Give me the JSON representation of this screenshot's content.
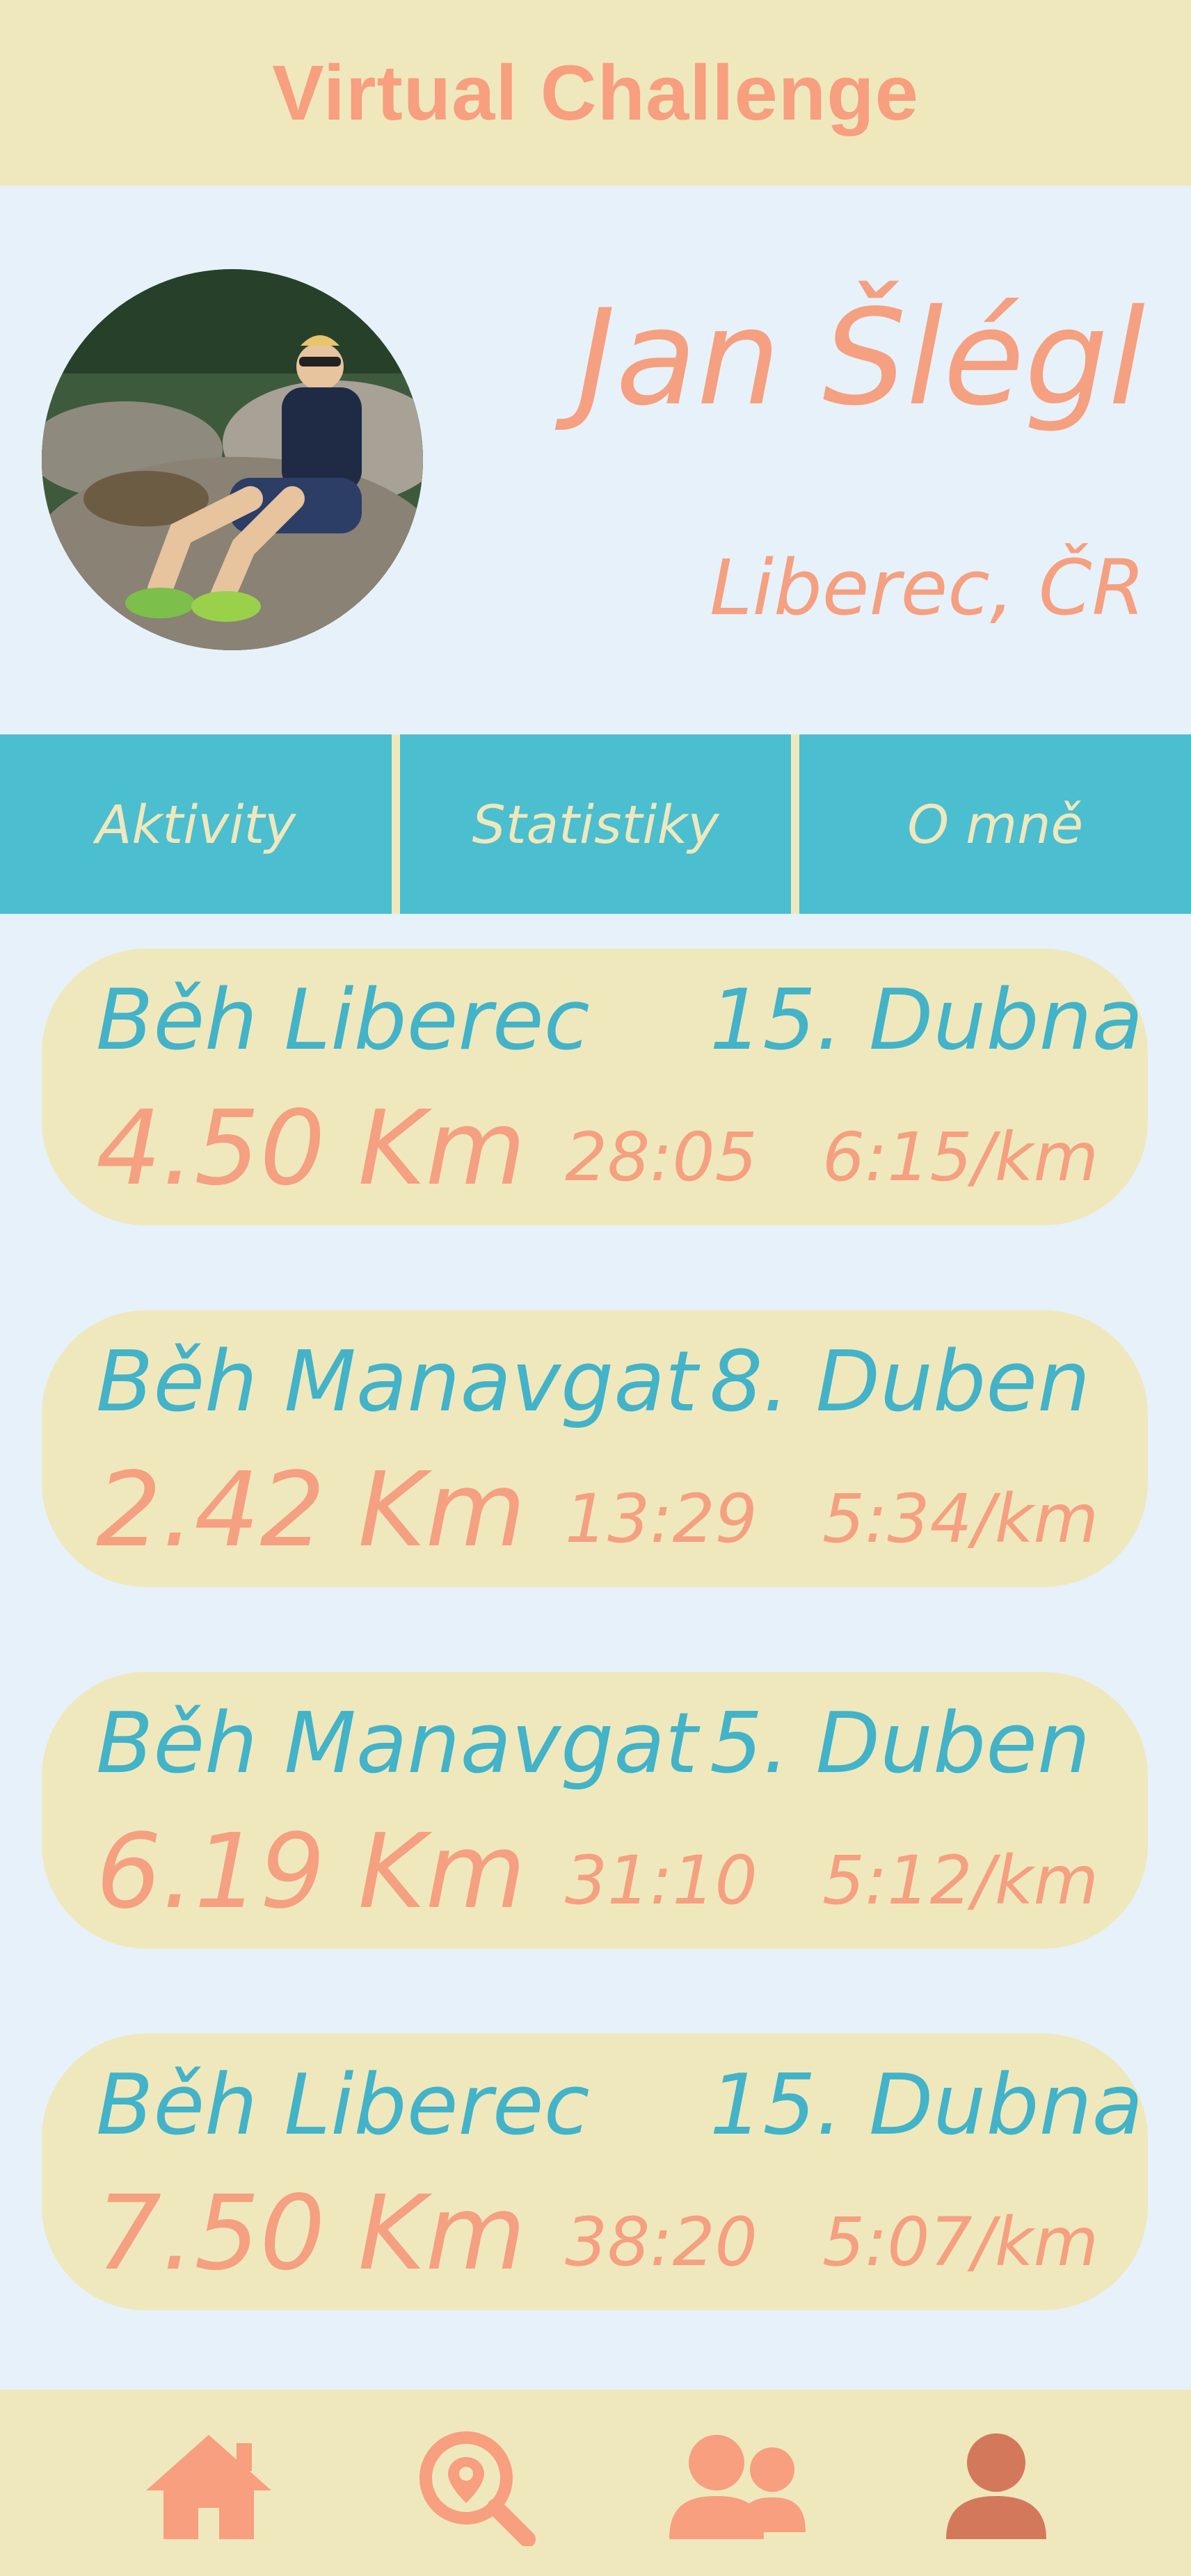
{
  "header": {
    "title": "Virtual Challenge"
  },
  "profile": {
    "name": "Jan Šlégl",
    "location": "Liberec, ČR"
  },
  "tabs": [
    {
      "label": "Aktivity"
    },
    {
      "label": "Statistiky"
    },
    {
      "label": "O mně"
    }
  ],
  "activities": [
    {
      "name": "Běh Liberec",
      "date": "15. Dubna",
      "distance": "4.50 Km",
      "time": "28:05",
      "pace": "6:15/km"
    },
    {
      "name": "Běh Manavgat",
      "date": "8. Duben",
      "distance": "2.42 Km",
      "time": "13:29",
      "pace": "5:34/km"
    },
    {
      "name": "Běh Manavgat",
      "date": "5. Duben",
      "distance": "6.19 Km",
      "time": "31:10",
      "pace": "5:12/km"
    },
    {
      "name": "Běh Liberec",
      "date": "15. Dubna",
      "distance": "7.50 Km",
      "time": "38:20",
      "pace": "5:07/km"
    }
  ],
  "nav": {
    "items": [
      {
        "icon": "home-icon"
      },
      {
        "icon": "location-search-icon"
      },
      {
        "icon": "users-icon"
      },
      {
        "icon": "profile-icon",
        "active": true
      }
    ]
  },
  "colors": {
    "cream": "#efe8bd",
    "background": "#e7f1f9",
    "teal": "#4bbecf",
    "coral": "#f5a080",
    "active_icon": "#d4785c"
  }
}
